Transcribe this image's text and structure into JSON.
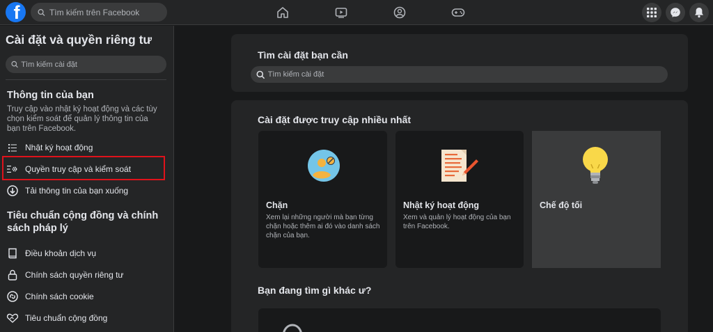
{
  "topbar": {
    "logo_letter": "f",
    "search_placeholder": "Tìm kiếm trên Facebook",
    "nav_icons": [
      "home-icon",
      "watch-icon",
      "groups-icon",
      "gaming-icon"
    ],
    "right_icons": [
      "menu-grid-icon",
      "messenger-icon",
      "notifications-icon"
    ]
  },
  "sidebar": {
    "title": "Cài đặt và quyền riêng tư",
    "search_placeholder": "Tìm kiếm cài đặt",
    "section1": {
      "heading": "Thông tin của bạn",
      "description": "Truy cập vào nhật ký hoạt động và các tùy chọn kiểm soát để quản lý thông tin của bạn trên Facebook.",
      "items": [
        {
          "label": "Nhật ký hoạt động",
          "icon": "list-icon"
        },
        {
          "label": "Quyền truy cập và kiểm soát",
          "icon": "settings-list-icon"
        },
        {
          "label": "Tải thông tin của bạn xuống",
          "icon": "download-icon"
        }
      ]
    },
    "section2": {
      "heading_line1": "Tiêu chuẩn cộng đồng và chính",
      "heading_line2": "sách pháp lý",
      "items": [
        {
          "label": "Điều khoản dịch vụ",
          "icon": "book-icon"
        },
        {
          "label": "Chính sách quyền riêng tư",
          "icon": "lock-icon"
        },
        {
          "label": "Chính sách cookie",
          "icon": "cookie-icon"
        },
        {
          "label": "Tiêu chuẩn cộng đồng",
          "icon": "heart-hands-icon"
        }
      ]
    }
  },
  "main": {
    "search_card": {
      "title": "Tìm cài đặt bạn cần",
      "search_placeholder": "Tìm kiếm cài đặt"
    },
    "most_used": {
      "title": "Cài đặt được truy cập nhiều nhất",
      "tiles": [
        {
          "title": "Chặn",
          "description": "Xem lại những người mà bạn từng chặn hoặc thêm ai đó vào danh sách chặn của bạn.",
          "icon": "block-user-icon"
        },
        {
          "title": "Nhật ký hoạt động",
          "description": "Xem và quản lý hoạt động của bạn trên Facebook.",
          "icon": "activity-log-icon"
        },
        {
          "title": "Chế độ tối",
          "description": "",
          "icon": "lightbulb-icon"
        }
      ]
    },
    "other": {
      "title": "Bạn đang tìm gì khác ư?"
    }
  },
  "colors": {
    "background": "#18191a",
    "surface": "#242526",
    "accent": "#1877f2",
    "highlight_border": "#e0121b"
  }
}
